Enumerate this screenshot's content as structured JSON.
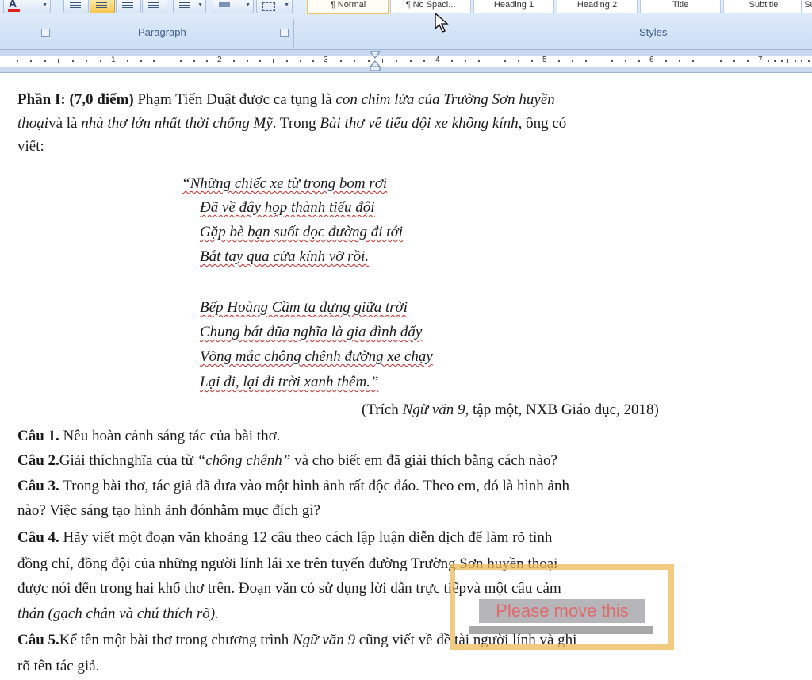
{
  "ribbon": {
    "groups": [
      "Paragraph",
      "Styles"
    ],
    "styles": [
      "¶ Normal",
      "¶ No Spaci...",
      "Heading 1",
      "Heading 2",
      "Title",
      "Subtitle",
      "Su"
    ],
    "selected_style": "Normal"
  },
  "ruler": {
    "numbers": [
      "1",
      "2",
      "3",
      "4",
      "5",
      "6",
      "7"
    ]
  },
  "document": {
    "part_title": "Phần I: (7,0 điểm)",
    "intro_1a": " Phạm Tiến Duật được ca tụng là ",
    "intro_1b": "con chim lửa của Trường Sơn huyền",
    "intro_2a": "thoại",
    "intro_2b": "và là ",
    "intro_2c": "nhà thơ lớn nhất thời chống Mỹ",
    "intro_2d": ". Trong ",
    "intro_2e": "Bài thơ về tiểu đội xe không kính",
    "intro_2f": ", ông có",
    "intro_3": "viết:",
    "poem": [
      "“Những chiếc xe từ trong bom rơi",
      "Đã về đây họp thành tiểu đội",
      "Gặp bè bạn suốt dọc đường đi tới",
      "Bắt tay qua cửa kính vỡ rồi.",
      "Bếp Hoàng Cầm ta dựng giữa trời",
      "Chung bát đũa nghĩa là gia đình đấy",
      "Võng mắc chông chênh đường xe chạy",
      "Lại đi, lại đi trời xanh thêm.”"
    ],
    "source_a": "(Trích ",
    "source_b": "Ngữ văn 9",
    "source_c": ", tập một, NXB Giáo dục, 2018)",
    "q1_label": "Câu 1.",
    "q1_text": " Nêu hoàn cảnh sáng tác của bài thơ.",
    "q2_label": "Câu 2.",
    "q2_text_a": "Giải thíchnghĩa của từ ",
    "q2_text_b": "“chông chênh”",
    "q2_text_c": " và cho biết em đã giải thích bằng cách nào?",
    "q3_label": "Câu 3.",
    "q3_text_1": " Trong bài thơ, tác giả đã đưa vào một hình ảnh rất độc đáo. Theo em, đó là hình ảnh",
    "q3_text_2": "nào? Việc sáng tạo hình ảnh đónhằm mục đích gì?",
    "q4_label": "Câu 4.",
    "q4_text_1": " Hãy viết một đoạn văn  khoảng 12 câu theo cách lập luận diễn dịch để làm rõ tình",
    "q4_text_2": "đồng chí, đồng đội của những người lính lái xe trên tuyến đường Trường Sơn huyền thoại",
    "q4_text_3": "được nói đến trong hai khổ thơ trên. Đoạn văn có sử dụng lời dẫn trực tiếpvà một câu cảm",
    "q4_text_4": "thán (gạch chân và chú thích rõ).",
    "q5_label": "Câu 5.",
    "q5_text_a": "Kể tên một bài thơ trong chương trình ",
    "q5_text_b": "Ngữ văn 9",
    "q5_text_c": " cũng viết về đề tài người lính và ghi",
    "q5_text_2": "rõ tên tác giả."
  },
  "overlay": {
    "text": "Please move this"
  },
  "colors": {
    "ribbon_bg": "#dbe7f7",
    "overlay_border": "#eeba5a",
    "overlay_text": "#e06a6a"
  }
}
